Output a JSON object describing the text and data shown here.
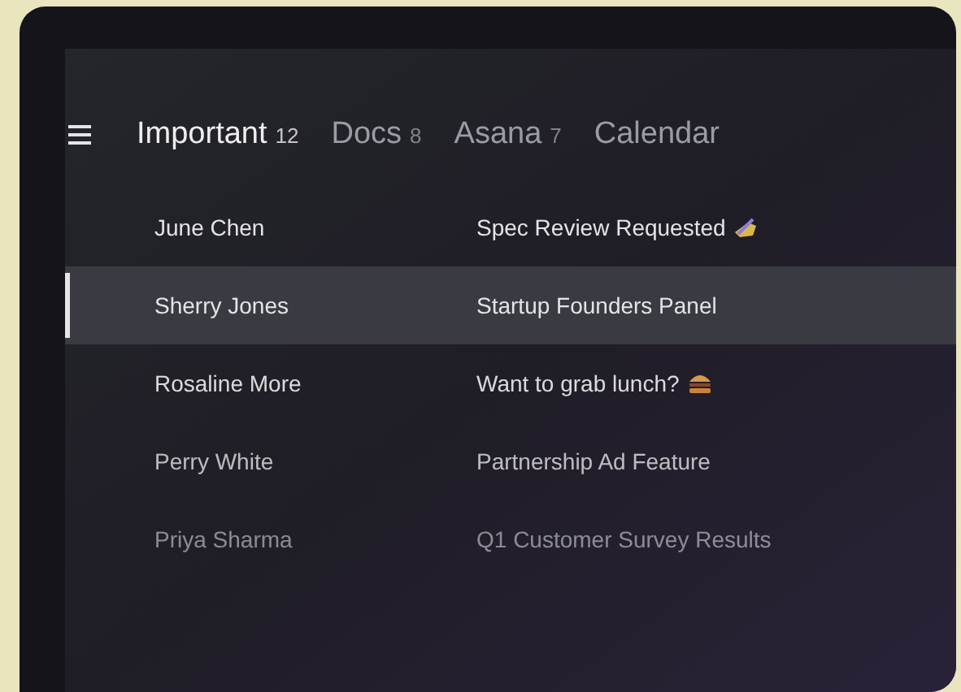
{
  "tabs": [
    {
      "label": "Important",
      "count": "12",
      "selected": true
    },
    {
      "label": "Docs",
      "count": "8",
      "selected": false
    },
    {
      "label": "Asana",
      "count": "7",
      "selected": false
    },
    {
      "label": "Calendar",
      "selected": false
    }
  ],
  "emails": [
    {
      "sender": "June Chen",
      "subject": "Spec Review Requested",
      "kind": "writing",
      "selected": false
    },
    {
      "sender": "Sherry Jones",
      "subject": "Startup Founders Panel",
      "kind": "plain",
      "selected": true
    },
    {
      "sender": "Rosaline More",
      "subject": "Want to grab lunch?",
      "kind": "burger",
      "selected": false
    },
    {
      "sender": "Perry White",
      "subject": "Partnership Ad Feature",
      "kind": "plain",
      "selected": false
    },
    {
      "sender": "Priya Sharma",
      "subject": "Q1 Customer Survey Results",
      "kind": "plain",
      "selected": false
    }
  ]
}
